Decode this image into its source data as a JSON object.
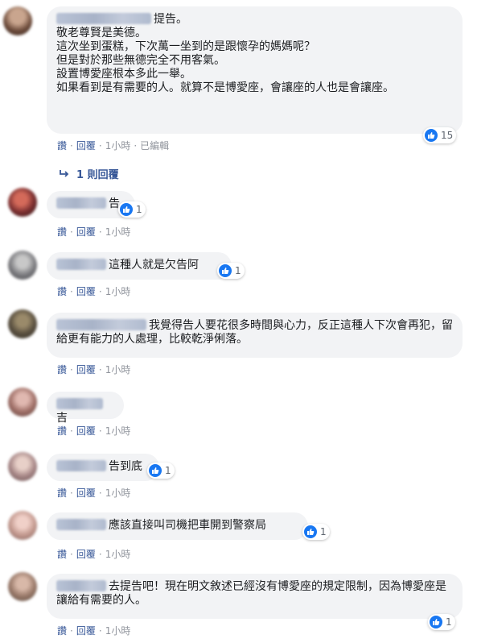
{
  "actions": {
    "like": "讚",
    "reply": "回覆",
    "sep": "·"
  },
  "comments": [
    {
      "text": "提告。\n敬老尊賢是美德。\n這次坐到蛋糕，下次萬一坐到的是跟懷孕的媽媽呢？\n但是對於那些無德完全不用客氣。\n設置博愛座根本多此一舉。\n如果看到是有需要的人。就算不是博愛座，會讓座的人也是會讓座。",
      "likes": "15",
      "time": "1小時",
      "edited": "已編輯",
      "reply_link": "1 則回覆"
    },
    {
      "text": "告",
      "likes": "1",
      "time": "1小時"
    },
    {
      "text": "這種人就是欠告阿",
      "likes": "1",
      "time": "1小時"
    },
    {
      "text": "我覺得告人要花很多時間與心力，反正這種人下次會再犯，留給更有能力的人處理，比較乾淨俐落。",
      "time": "1小時"
    },
    {
      "text": "吉",
      "time": "1小時"
    },
    {
      "text": "告到底",
      "likes": "1",
      "time": "1小時"
    },
    {
      "text": "應該直接叫司機把車開到警察局",
      "likes": "1",
      "time": "1小時"
    },
    {
      "text": "去提告吧！現在明文敘述已經沒有博愛座的規定限制，因為博愛座是讓給有需要的人。",
      "likes": "1",
      "time": "1小時"
    }
  ],
  "colors": {
    "like_blue": "#1877f2",
    "link": "#385898",
    "bubble": "#f2f3f5"
  }
}
